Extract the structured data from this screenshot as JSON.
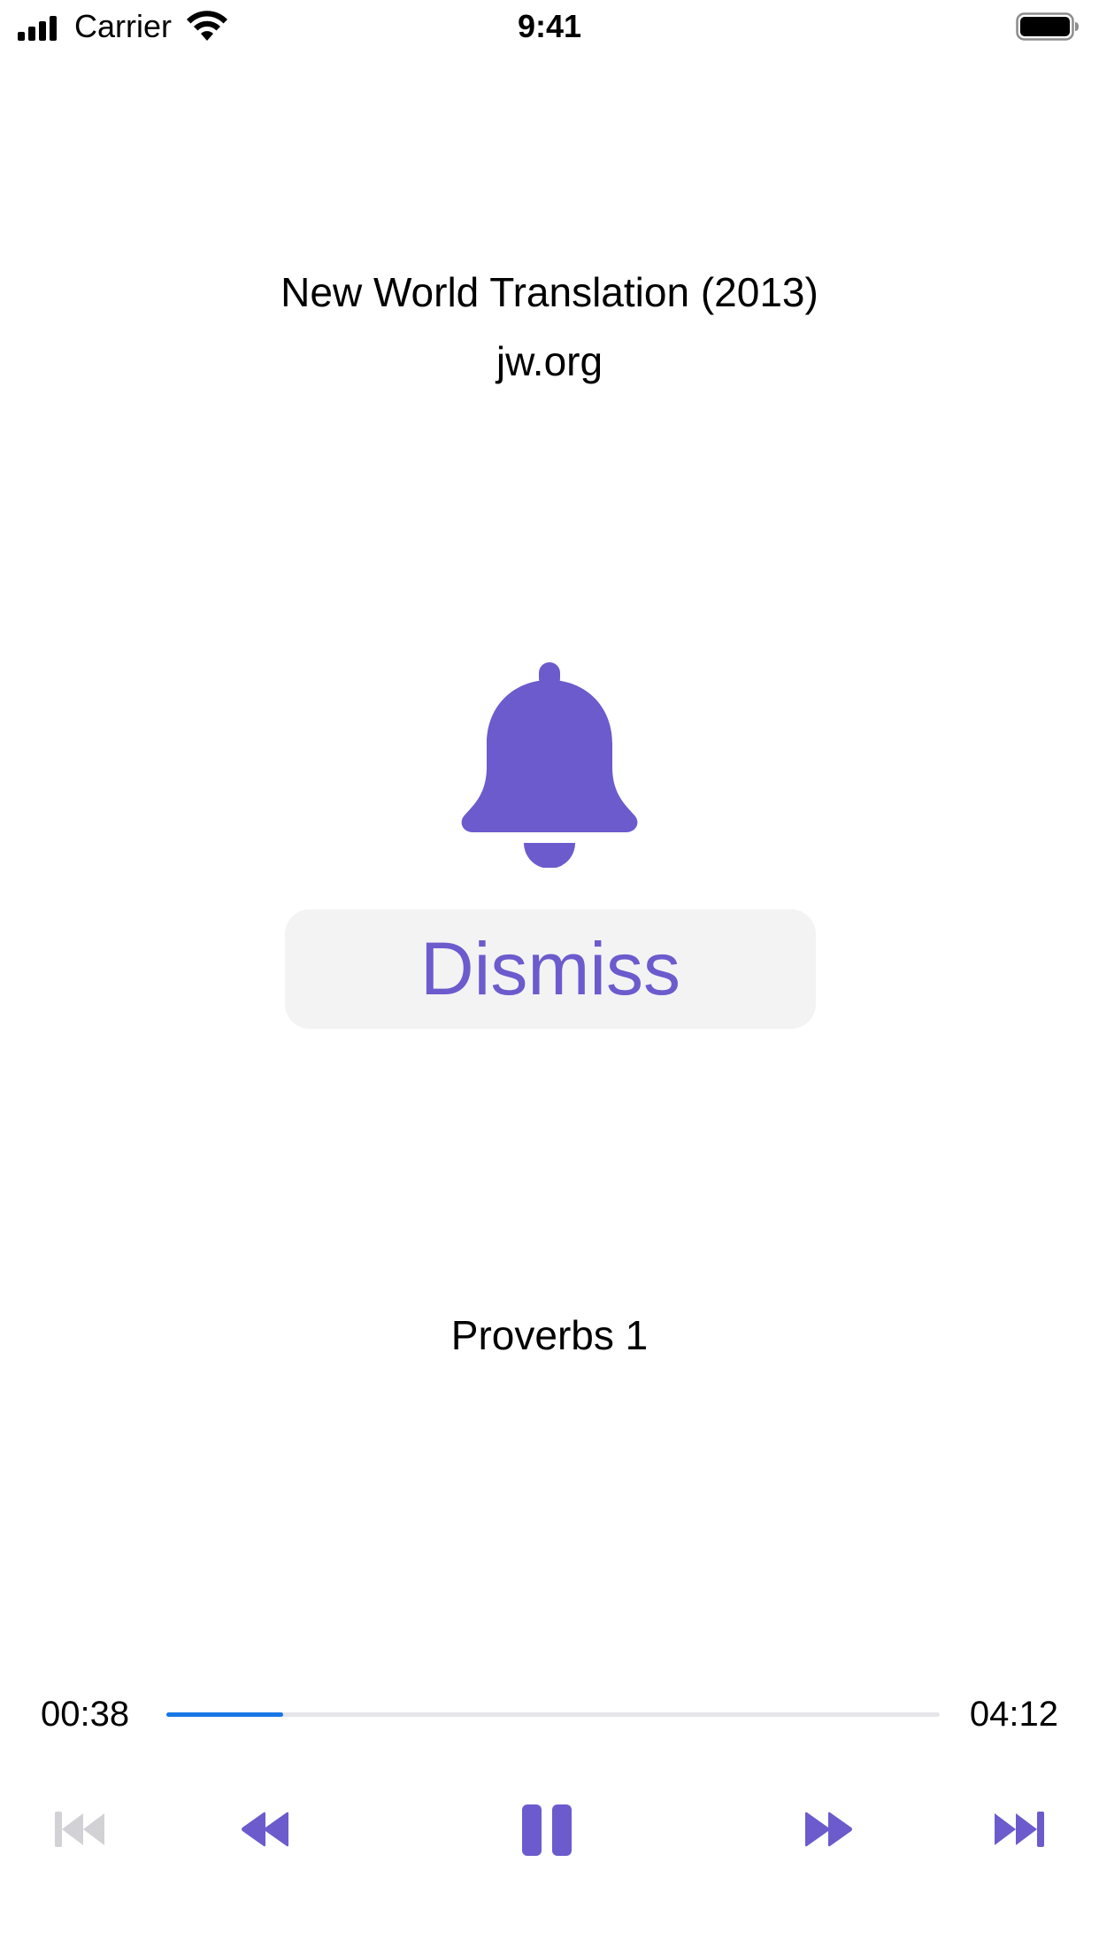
{
  "status_bar": {
    "carrier": "Carrier",
    "time": "9:41"
  },
  "header": {
    "title": "New World Translation (2013)",
    "subtitle": "jw.org"
  },
  "alarm": {
    "icon": "bell-icon",
    "dismiss_label": "Dismiss"
  },
  "player": {
    "chapter": "Proverbs 1",
    "elapsed": "00:38",
    "duration": "04:12",
    "progress_fraction": 0.151,
    "controls": {
      "previous": "skip-previous-icon",
      "rewind": "rewind-icon",
      "play_pause": "pause-icon",
      "fast_forward": "fast-forward-icon",
      "next": "skip-next-icon"
    }
  },
  "colors": {
    "accent": "#6b5bcd",
    "progress": "#1777e6",
    "track": "#e5e5ea",
    "disabled": "#d1d1d6",
    "button_bg": "#f3f3f4"
  }
}
